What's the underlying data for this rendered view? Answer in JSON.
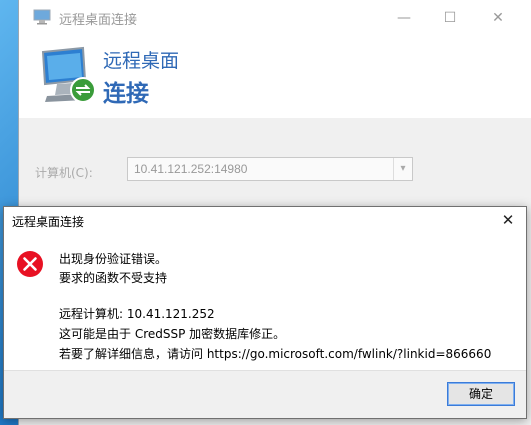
{
  "main_window": {
    "title": "远程桌面连接",
    "banner_line1": "远程桌面",
    "banner_line2": "连接",
    "computer_label": "计算机(C):",
    "computer_value": "10.41.121.252:14980",
    "controls": {
      "minimize": "—",
      "maximize": "☐",
      "close": "✕"
    }
  },
  "dialog": {
    "title": "远程桌面连接",
    "close_glyph": "✕",
    "icon": "error-icon",
    "lines": [
      "出现身份验证错误。",
      "要求的函数不受支持",
      "远程计算机: 10.41.121.252",
      "这可能是由于 CredSSP 加密数据库修正。",
      "若要了解详细信息，请访问 https://go.microsoft.com/fwlink/?linkid=866660"
    ],
    "ok_label": "确定"
  },
  "colors": {
    "accent_blue": "#2f69b6",
    "error_red": "#e81123",
    "focus_border": "#3b7bd8"
  }
}
